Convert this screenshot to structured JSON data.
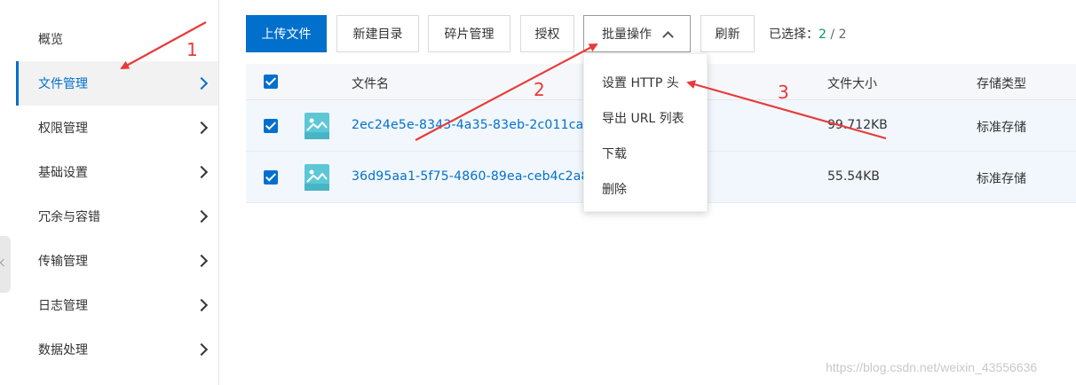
{
  "sidebar": {
    "items": [
      {
        "label": "概览"
      },
      {
        "label": "文件管理"
      },
      {
        "label": "权限管理"
      },
      {
        "label": "基础设置"
      },
      {
        "label": "冗余与容错"
      },
      {
        "label": "传输管理"
      },
      {
        "label": "日志管理"
      },
      {
        "label": "数据处理"
      }
    ]
  },
  "toolbar": {
    "upload": "上传文件",
    "new_dir": "新建目录",
    "fragments": "碎片管理",
    "authorize": "授权",
    "batch": "批量操作",
    "refresh": "刷新",
    "selected_label": "已选择：",
    "selected_count": "2",
    "separator": " / ",
    "selected_total": "2"
  },
  "table": {
    "columns": {
      "name": "文件名",
      "size": "文件大小",
      "storage": "存储类型"
    },
    "rows": [
      {
        "name": "2ec24e5e-8343-4a35-83eb-2c011ca2",
        "size": "99.712KB",
        "storage": "标准存储"
      },
      {
        "name": "36d95aa1-5f75-4860-89ea-ceb4c2a8",
        "size": "55.54KB",
        "storage": "标准存储"
      }
    ]
  },
  "dropdown": {
    "items": [
      {
        "label": "设置 HTTP 头"
      },
      {
        "label": "导出 URL 列表"
      },
      {
        "label": "下载"
      },
      {
        "label": "删除"
      }
    ]
  },
  "annotations": {
    "n1": "1",
    "n2": "2",
    "n3": "3"
  },
  "watermark": "https://blog.csdn.net/weixin_43556636",
  "colors": {
    "accent": "#0070cc",
    "annotation": "#e83a3a",
    "selected_count": "#009a61"
  }
}
